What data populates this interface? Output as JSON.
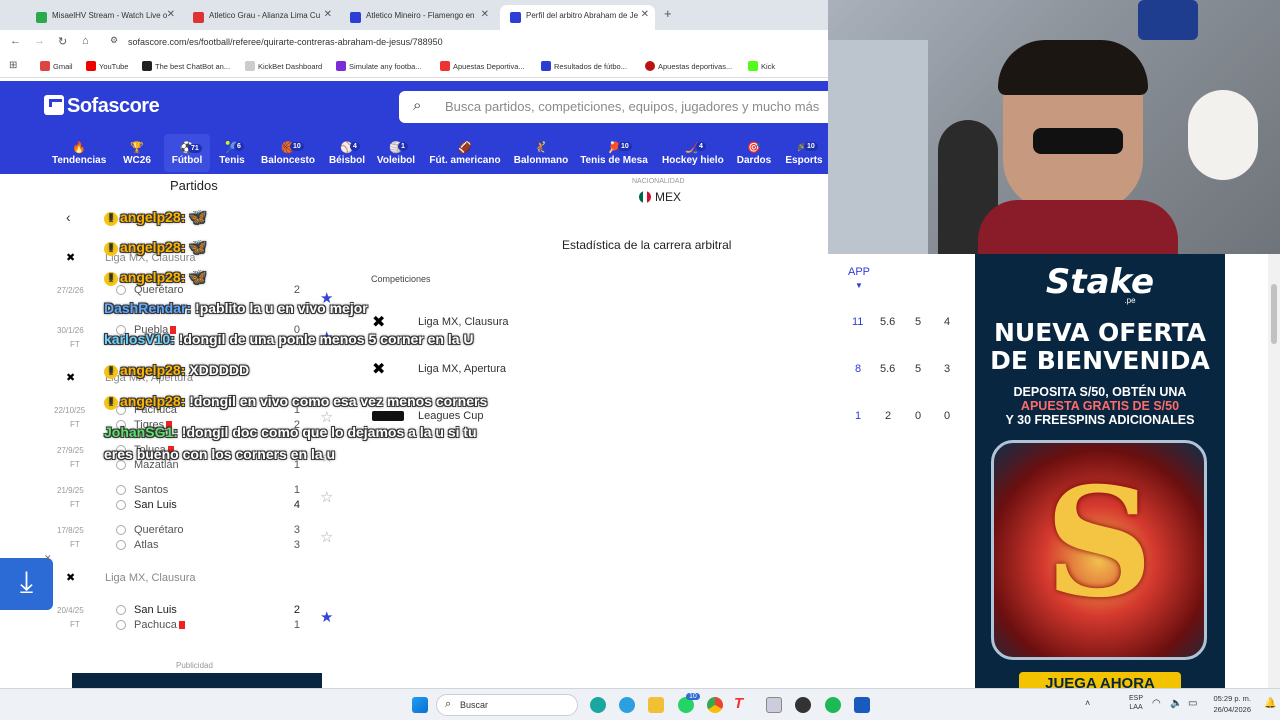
{
  "browser": {
    "tabs": [
      {
        "title": "MisaelHV Stream - Watch Live o",
        "color": "#2ca84f"
      },
      {
        "title": "Atletico Grau - Alianza Lima Cu",
        "color": "#d33"
      },
      {
        "title": "Atletico Mineiro - Flamengo en",
        "color": "#2c3ed6"
      },
      {
        "title": "Perfil del arbitro Abraham de Je",
        "color": "#2c3ed6"
      }
    ],
    "url": "sofascore.com/es/football/referee/quirarte-contreras-abraham-de-jesus/788950",
    "bookmarks": [
      {
        "label": "Gmail",
        "color": "#d44"
      },
      {
        "label": "YouTube",
        "color": "#e00"
      },
      {
        "label": "The best ChatBot an...",
        "color": "#222"
      },
      {
        "label": "KickBet Dashboard",
        "color": "#ccc"
      },
      {
        "label": "Simulate any footba...",
        "color": "#7b2cd6"
      },
      {
        "label": "Apuestas Deportiva...",
        "color": "#e33"
      },
      {
        "label": "Resultados de fútbo...",
        "color": "#2c3ed6"
      },
      {
        "label": "Apuestas deportivas...",
        "color": "#b11"
      },
      {
        "label": "Kick",
        "color": "#53fc18"
      }
    ]
  },
  "sofascore": {
    "logo": "Sofascore",
    "search_placeholder": "Busca partidos, competiciones, equipos, jugadores y mucho más",
    "sports": [
      {
        "label": "Tendencias",
        "icon": "🔥",
        "count": ""
      },
      {
        "label": "WC26",
        "icon": "🏆",
        "count": ""
      },
      {
        "label": "Fútbol",
        "icon": "⚽",
        "count": "71"
      },
      {
        "label": "Tenis",
        "icon": "🎾",
        "count": "6"
      },
      {
        "label": "Baloncesto",
        "icon": "🏀",
        "count": "10"
      },
      {
        "label": "Béisbol",
        "icon": "⚾",
        "count": "4"
      },
      {
        "label": "Voleibol",
        "icon": "🏐",
        "count": "1"
      },
      {
        "label": "Fút. americano",
        "icon": "🏈",
        "count": ""
      },
      {
        "label": "Balonmano",
        "icon": "🤾",
        "count": ""
      },
      {
        "label": "Tenis de Mesa",
        "icon": "🏓",
        "count": "10"
      },
      {
        "label": "Hockey hielo",
        "icon": "🏒",
        "count": "4"
      },
      {
        "label": "Dardos",
        "icon": "🎯",
        "count": ""
      },
      {
        "label": "Esports",
        "icon": "🎮",
        "count": "10"
      }
    ],
    "matches_title": "Partidos",
    "nationality_label": "NACIONALIDAD",
    "nationality": "MEX",
    "career_title": "Estadística de la carrera arbitral",
    "competitions_header": "Competiciones",
    "app_header": "APP",
    "competitions": [
      {
        "name": "Liga MX, Clausura",
        "app": "11",
        "v1": "5.6",
        "v2": "5",
        "v3": "4"
      },
      {
        "name": "Liga MX, Apertura",
        "app": "8",
        "v1": "5.6",
        "v2": "5",
        "v3": "3"
      },
      {
        "name": "Leagues Cup",
        "app": "1",
        "v1": "2",
        "v2": "0",
        "v3": "0"
      }
    ],
    "league_headers": [
      "Liga MX, Clausura",
      "Liga MX, Apertura",
      "Liga MX, Clausura"
    ],
    "matches": [
      {
        "date": "27/2/26",
        "status": "FT",
        "home": "Querétaro",
        "away": "",
        "hs": "2",
        "as": ""
      },
      {
        "date": "30/1/26",
        "status": "FT",
        "home": "Puebla",
        "away": "",
        "hs": "0",
        "as": ""
      },
      {
        "date": "22/10/25",
        "status": "FT",
        "home": "Pachuca",
        "away": "Tigres",
        "hs": "1",
        "as": "2"
      },
      {
        "date": "27/9/25",
        "status": "FT",
        "home": "Toluca",
        "away": "Mazatlán",
        "hs": "",
        "as": "1"
      },
      {
        "date": "21/9/25",
        "status": "FT",
        "home": "Santos",
        "away": "San Luis",
        "hs": "1",
        "as": "4"
      },
      {
        "date": "17/8/25",
        "status": "FT",
        "home": "Querétaro",
        "away": "Atlas",
        "hs": "3",
        "as": "3"
      },
      {
        "date": "20/4/25",
        "status": "FT",
        "home": "San Luis",
        "away": "Pachuca",
        "hs": "2",
        "as": "1"
      }
    ],
    "ad_label": "Publicidad"
  },
  "chat": [
    {
      "user": "angelp28:",
      "msg": "🦋"
    },
    {
      "user": "angelp28:",
      "msg": "🦋"
    },
    {
      "user": "angelp28:",
      "msg": "🦋"
    },
    {
      "user": "DashRendar:",
      "msg": "!pablito la u en vivo mejor"
    },
    {
      "user": "karlosV10:",
      "msg": "!dongil de una ponle menos 5 corner en la U"
    },
    {
      "user": "angelp28:",
      "msg": "XDDDDD"
    },
    {
      "user": "angelp28:",
      "msg": "!dongil en vivo como esa vez menos corners"
    },
    {
      "user": "JohanSG1:",
      "msg": "!dongil doc como que lo dejamos a la u si tu"
    },
    {
      "user": "",
      "msg": "eres bueno con los corners en la u"
    }
  ],
  "stake_ad": {
    "brand": "Stake",
    "brand_sub": ".pe",
    "headline": "NUEVA OFERTA DE BIENVENIDA",
    "line1": "DEPOSITA S/50, OBTÉN UNA",
    "line2": "APUESTA GRATIS DE S/50",
    "line3": "Y 30 FREESPINS ADICIONALES",
    "cta": "JUEGA AHORA"
  },
  "taskbar": {
    "search": "Buscar",
    "lang1": "ESP",
    "lang2": "LAA",
    "time": "05:29 p. m.",
    "date": "26/04/2026",
    "badge": "10"
  }
}
